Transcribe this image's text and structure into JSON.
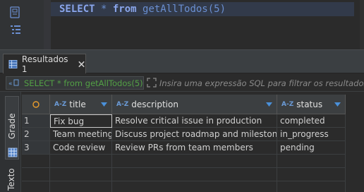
{
  "editor": {
    "sql_keyword_select": "SELECT",
    "sql_star": " * ",
    "sql_keyword_from": "from",
    "sql_function": " getAllTodos(5)"
  },
  "results_tab": {
    "label": "Resultados 1"
  },
  "filter": {
    "query_text": "SELECT * from getAllTodos(5)",
    "placeholder": "Insira uma expressão SQL para filtrar os resultados (u"
  },
  "side_tabs": {
    "grade_label": "Grade",
    "texto_label": "Texto"
  },
  "grid": {
    "sort_badge": "A-Z",
    "columns": [
      {
        "label": "title"
      },
      {
        "label": "description"
      },
      {
        "label": "status"
      }
    ],
    "rows": [
      {
        "num": "1",
        "title": "Fix bug",
        "description": "Resolve critical issue in production",
        "status": "completed"
      },
      {
        "num": "2",
        "title": "Team meeting",
        "description": "Discuss project roadmap and milestones",
        "status": "in_progress"
      },
      {
        "num": "3",
        "title": "Code review",
        "description": "Review PRs from team members",
        "status": "pending"
      }
    ]
  },
  "colors": {
    "background": "#2b2b2b",
    "sql_keyword": "#8aa6ec",
    "filter_query": "#53a045",
    "header_bg": "#3c3f41",
    "accent_orange": "#e89c2c",
    "accent_blue": "#4a90d9"
  },
  "icons": {
    "gutter_top": "sql-console-icon",
    "gutter_bottom": "outline-icon",
    "tab": "results-grid-icon",
    "tab_close": "close-icon",
    "filter_sql": "sql-icon",
    "filter_expand": "expand-icon",
    "grade": "grid-icon",
    "corner": "circle-icon",
    "header_menu": "chevron-down-icon"
  }
}
